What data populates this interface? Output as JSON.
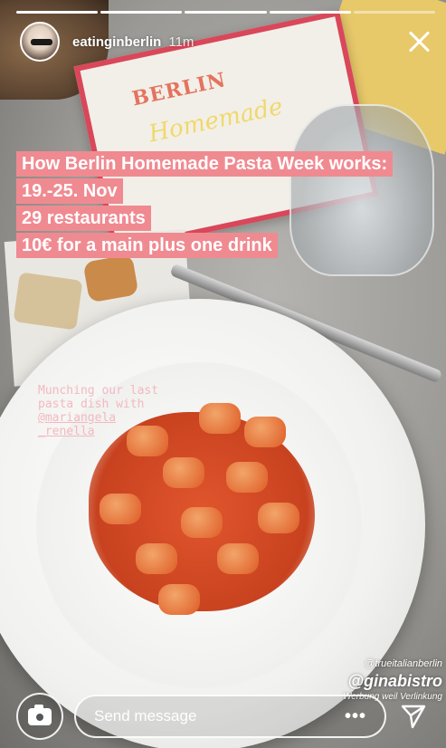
{
  "story": {
    "progress_segments": 5,
    "progress_done": 4
  },
  "header": {
    "username": "eatinginberlin",
    "time": "11m"
  },
  "photo": {
    "flyer_title": "BERLIN",
    "flyer_sub": "Homemade"
  },
  "caption": {
    "lines": [
      "How Berlin Homemade Pasta Week works:",
      "19.-25. Nov",
      "29 restaurants",
      "10€ for a main plus one drink"
    ]
  },
  "mention": {
    "text1": "Munching our last",
    "text2": "pasta dish with",
    "handle": "@mariangela",
    "handle2": "_renella"
  },
  "tags": {
    "small": "@trueitalianberlin",
    "big": "@ginabistro",
    "note": "Werbung weil Verlinkung"
  },
  "bottom": {
    "message_placeholder": "Send message",
    "more": "•••"
  },
  "colors": {
    "caption_bg": "#f08a91",
    "mention_text": "#f3b6bd"
  }
}
